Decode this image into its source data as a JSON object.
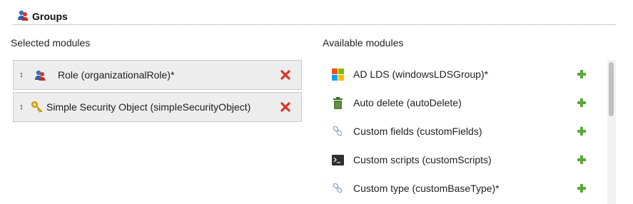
{
  "header": {
    "title": "Groups",
    "icon": "group-icon"
  },
  "selected": {
    "title": "Selected modules",
    "items": [
      {
        "label": "Role (organizationalRole)*",
        "icon": "person-icon"
      },
      {
        "label": "Simple Security Object (simpleSecurityObject)",
        "icon": "key-icon"
      }
    ]
  },
  "available": {
    "title": "Available modules",
    "items": [
      {
        "label": "AD LDS (windowsLDSGroup)*",
        "icon": "windows-logo-icon"
      },
      {
        "label": "Auto delete (autoDelete)",
        "icon": "trash-icon"
      },
      {
        "label": "Custom fields (customFields)",
        "icon": "link-icon"
      },
      {
        "label": "Custom scripts (customScripts)",
        "icon": "terminal-icon"
      },
      {
        "label": "Custom type (customBaseType)*",
        "icon": "link-icon"
      }
    ]
  },
  "colors": {
    "remove": "#d9352b",
    "add": "#5aa838",
    "selected_bg": "#ededed",
    "scroll_thumb": "#c1c1c1"
  }
}
